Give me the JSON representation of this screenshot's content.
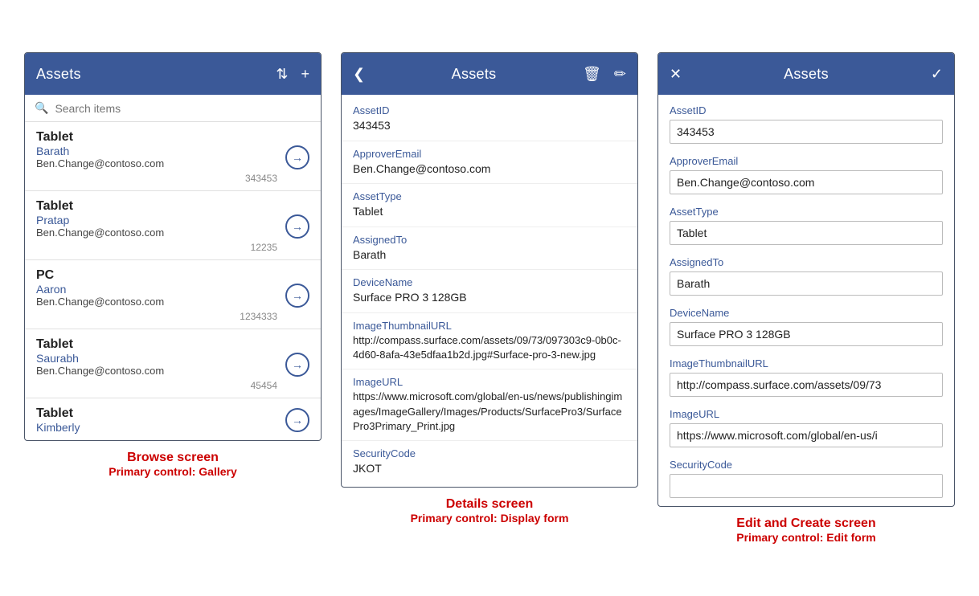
{
  "screens": {
    "browse": {
      "header": {
        "title": "Assets",
        "sort_icon": "⇅",
        "add_icon": "+"
      },
      "search": {
        "placeholder": "Search items"
      },
      "items": [
        {
          "type": "Tablet",
          "name": "Barath",
          "email": "Ben.Change@contoso.com",
          "id": "343453"
        },
        {
          "type": "Tablet",
          "name": "Pratap",
          "email": "Ben.Change@contoso.com",
          "id": "12235"
        },
        {
          "type": "PC",
          "name": "Aaron",
          "email": "Ben.Change@contoso.com",
          "id": "1234333"
        },
        {
          "type": "Tablet",
          "name": "Saurabh",
          "email": "Ben.Change@contoso.com",
          "id": "45454"
        },
        {
          "type": "Tablet",
          "name": "Kimberly",
          "email": "",
          "id": ""
        }
      ],
      "label_main": "Browse screen",
      "label_sub": "Primary control: Gallery"
    },
    "details": {
      "header": {
        "title": "Assets",
        "back_icon": "❮",
        "delete_icon": "🗑",
        "edit_icon": "✏"
      },
      "fields": [
        {
          "label": "AssetID",
          "value": "343453"
        },
        {
          "label": "ApproverEmail",
          "value": "Ben.Change@contoso.com"
        },
        {
          "label": "AssetType",
          "value": "Tablet"
        },
        {
          "label": "AssignedTo",
          "value": "Barath"
        },
        {
          "label": "DeviceName",
          "value": "Surface PRO 3 128GB"
        },
        {
          "label": "ImageThumbnailURL",
          "value": "http://compass.surface.com/assets/09/73/097303c9-0b0c-4d60-8afa-43e5dfaa1b2d.jpg#Surface-pro-3-new.jpg"
        },
        {
          "label": "ImageURL",
          "value": "https://www.microsoft.com/global/en-us/news/publishingimages/ImageGallery/Images/Products/SurfacePro3/SurfacePro3Primary_Print.jpg"
        },
        {
          "label": "SecurityCode",
          "value": "JKOT"
        }
      ],
      "label_main": "Details screen",
      "label_sub": "Primary control: Display form"
    },
    "edit": {
      "header": {
        "title": "Assets",
        "close_icon": "✕",
        "check_icon": "✓"
      },
      "fields": [
        {
          "label": "AssetID",
          "value": "343453"
        },
        {
          "label": "ApproverEmail",
          "value": "Ben.Change@contoso.com"
        },
        {
          "label": "AssetType",
          "value": "Tablet"
        },
        {
          "label": "AssignedTo",
          "value": "Barath"
        },
        {
          "label": "DeviceName",
          "value": "Surface PRO 3 128GB"
        },
        {
          "label": "ImageThumbnailURL",
          "value": "http://compass.surface.com/assets/09/73"
        },
        {
          "label": "ImageURL",
          "value": "https://www.microsoft.com/global/en-us/i"
        },
        {
          "label": "SecurityCode",
          "value": ""
        }
      ],
      "label_main": "Edit and Create screen",
      "label_sub": "Primary control: Edit form"
    }
  }
}
